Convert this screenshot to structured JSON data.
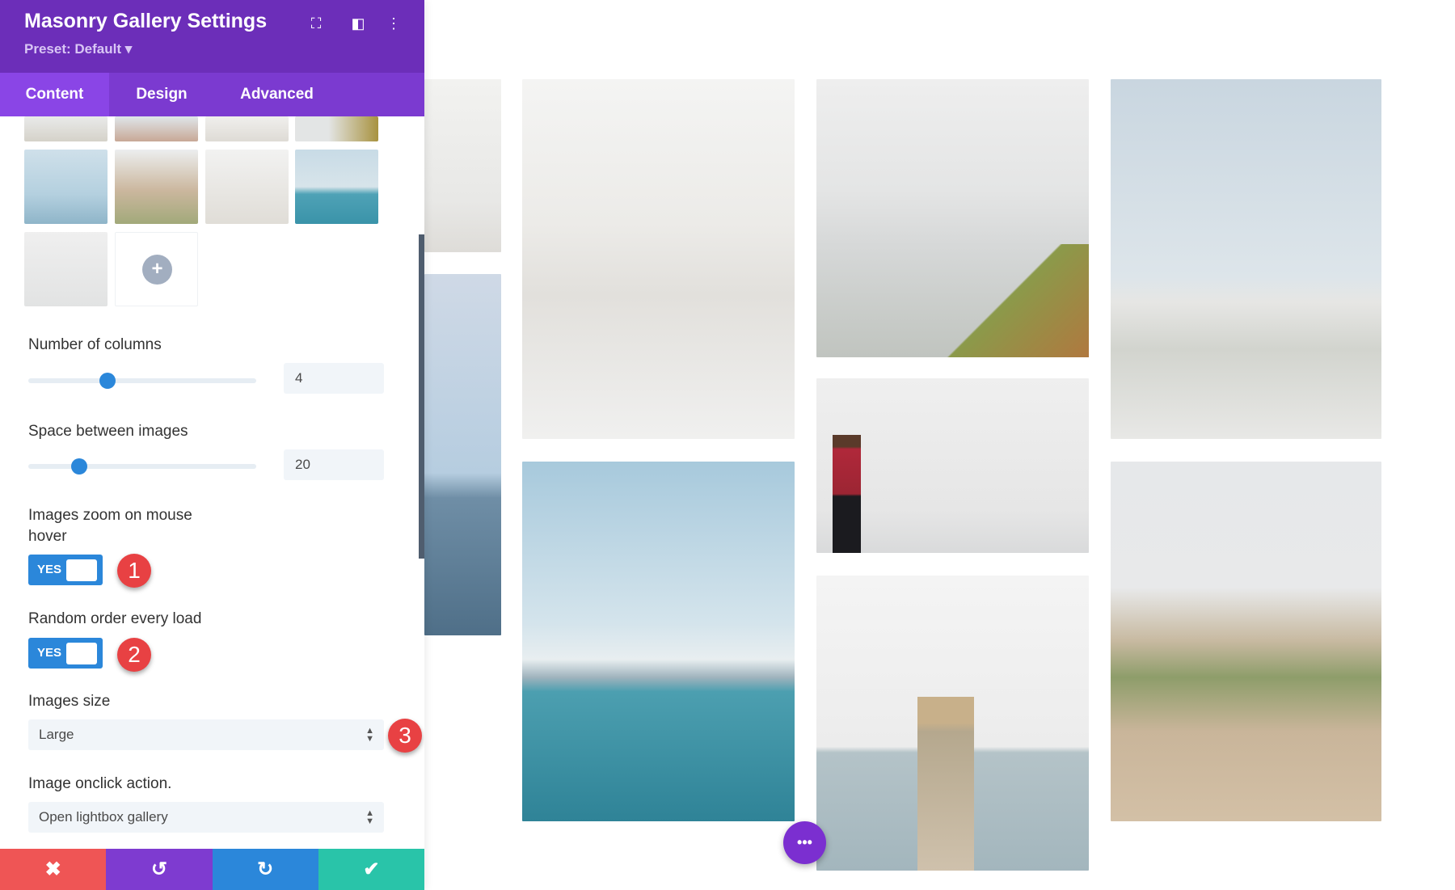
{
  "panel": {
    "title": "Masonry Gallery Settings",
    "preset": "Preset: Default ▾",
    "header_icons": [
      "focus-icon",
      "split-view-icon",
      "more-vertical-icon"
    ],
    "tabs": [
      {
        "label": "Content",
        "active": true
      },
      {
        "label": "Design"
      },
      {
        "label": "Advanced"
      }
    ],
    "gallery_add_icon": "+",
    "columns": {
      "label": "Number of columns",
      "value": "4",
      "slider_fraction": 0.35
    },
    "spacing": {
      "label": "Space between images",
      "value": "20",
      "slider_fraction": 0.22
    },
    "zoom_hover": {
      "label": "Images zoom on mouse hover",
      "toggle": "YES",
      "badge": "1"
    },
    "random_order": {
      "label": "Random order every load",
      "toggle": "YES",
      "badge": "2"
    },
    "images_size": {
      "label": "Images size",
      "value": "Large",
      "badge": "3"
    },
    "onclick": {
      "label": "Image onclick action.",
      "value": "Open lightbox gallery"
    },
    "bottom_bar": [
      {
        "icon": "close-icon",
        "glyph": "✖",
        "color": "#ef5555"
      },
      {
        "icon": "undo-icon",
        "glyph": "↺",
        "color": "#7e3bd0"
      },
      {
        "icon": "redo-icon",
        "glyph": "↻",
        "color": "#2b87da"
      },
      {
        "icon": "check-icon",
        "glyph": "✔",
        "color": "#29c4a9"
      }
    ]
  },
  "canvas": {
    "fab_label": "•••"
  },
  "colors": {
    "header": "#6c2eb9",
    "tabs": "#7b3ad0",
    "active_tab": "#8a45e6",
    "accent": "#2b87da",
    "badge": "#e84143"
  }
}
